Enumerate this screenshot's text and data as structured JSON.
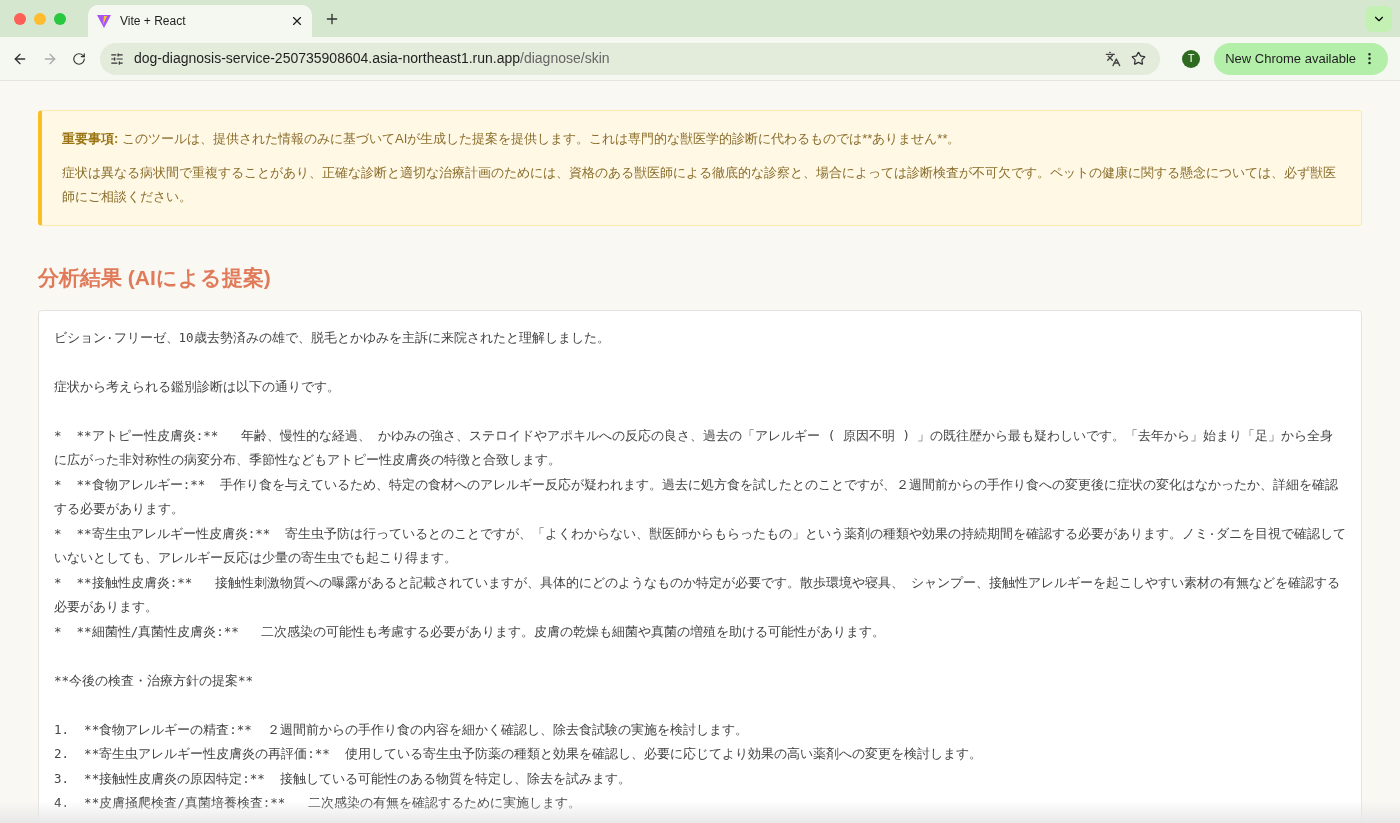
{
  "browser": {
    "tab_title": "Vite + React",
    "url_host": "dog-diagnosis-service-250735908604.asia-northeast1.run.app",
    "url_path": "/diagnose/skin",
    "profile_initial": "T",
    "update_button": "New Chrome available"
  },
  "notice": {
    "label": "重要事項:",
    "text": "このツールは、提供された情報のみに基づいてAIが生成した提案を提供します。これは専門的な獣医学的診断に代わるものでは**ありません**。",
    "detail": "症状は異なる病状間で重複することがあり、正確な診断と適切な治療計画のためには、資格のある獣医師による徹底的な診察と、場合によっては診断検査が不可欠です。ペットの健康に関する懸念については、必ず獣医師にご相談ください。"
  },
  "result": {
    "heading": "分析結果 (AIによる提案)",
    "blocks": [
      [
        "ビション·フリーゼ、10歳去勢済みの雄で、脱毛とかゆみを主訴に来院されたと理解しました。"
      ],
      [
        "症状から考えられる鑑別診断は以下の通りです。"
      ],
      [
        "*  **アトピー性皮膚炎:**   年齢、慢性的な経過、 かゆみの強さ、ステロイドやアポキルへの反応の良さ、過去の「アレルギー ( 原因不明 ) 」の既往歴から最も疑わしいです。「去年から」始まり「足」から全身に広がった非対称性の病変分布、季節性などもアトピー性皮膚炎の特徴と合致します。",
        "*  **食物アレルギー:**  手作り食を与えているため、特定の食材へのアレルギー反応が疑われます。過去に処方食を試したとのことですが、２週間前からの手作り食への変更後に症状の変化はなかったか、詳細を確認する必要があります。",
        "*  **寄生虫アレルギー性皮膚炎:**  寄生虫予防は行っているとのことですが、「よくわからない、獣医師からもらったもの」という薬剤の種類や効果の持続期間を確認する必要があります。ノミ·ダニを目視で確認していないとしても、アレルギー反応は少量の寄生虫でも起こり得ます。",
        "*  **接触性皮膚炎:**   接触性刺激物質への曝露があると記載されていますが、具体的にどのようなものか特定が必要です。散歩環境や寝具、 シャンプー、接触性アレルギーを起こしやすい素材の有無などを確認する必要があります。",
        "*  **細菌性/真菌性皮膚炎:**   二次感染の可能性も考慮する必要があります。皮膚の乾燥も細菌や真菌の増殖を助ける可能性があります。"
      ],
      [
        "**今後の検査・治療方針の提案**"
      ],
      [
        "1.  **食物アレルギーの精査:**  ２週間前からの手作り食の内容を細かく確認し、除去食試験の実施を検討します。",
        "2.  **寄生虫アレルギー性皮膚炎の再評価:**  使用している寄生虫予防薬の種類と効果を確認し、必要に応じてより効果の高い薬剤への変更を検討します。",
        "3.  **接触性皮膚炎の原因特定:**  接触している可能性のある物質を特定し、除去を試みます。",
        "4.  **皮膚掻爬検査/真菌培養検査:**   二次感染の有無を確認するために実施します。"
      ]
    ]
  }
}
